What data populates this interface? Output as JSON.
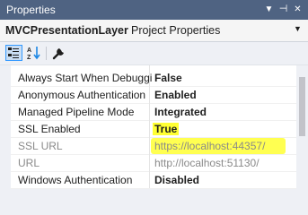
{
  "window": {
    "title": "Properties"
  },
  "header": {
    "object_name": "MVCPresentationLayer",
    "object_type": "Project Properties"
  },
  "toolbar": {
    "buttons": [
      {
        "icon": "categorized-icon",
        "active": true
      },
      {
        "icon": "alphabetical-sort-icon",
        "active": false
      },
      {
        "icon": "wrench-icon",
        "active": false
      }
    ]
  },
  "properties": [
    {
      "name": "Always Start When Debuggi",
      "value": "False"
    },
    {
      "name": "Anonymous Authentication",
      "value": "Enabled"
    },
    {
      "name": "Managed Pipeline Mode",
      "value": "Integrated"
    },
    {
      "name": "SSL Enabled",
      "value": "True"
    },
    {
      "name": "SSL URL",
      "value": "https://localhost:44357/"
    },
    {
      "name": "URL",
      "value": "http://localhost:51130/"
    },
    {
      "name": "Windows Authentication",
      "value": "Disabled"
    }
  ],
  "colors": {
    "titlebar": "#4f6382",
    "highlight": "#ffff33",
    "accent": "#3399ff"
  }
}
